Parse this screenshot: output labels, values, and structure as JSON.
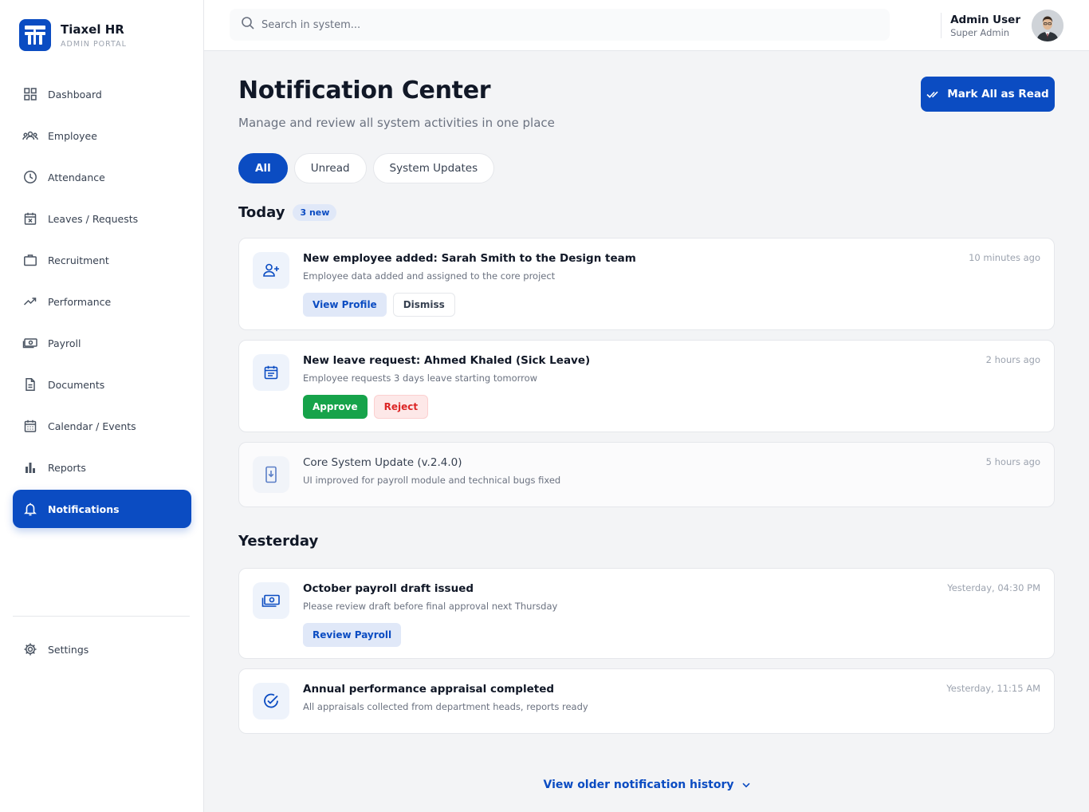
{
  "brand": {
    "name": "Tiaxel HR",
    "subtitle": "ADMIN PORTAL",
    "logo_icon": "tiaxel-logo"
  },
  "sidebar": {
    "items": [
      {
        "label": "Dashboard",
        "icon": "grid-icon"
      },
      {
        "label": "Employee",
        "icon": "users-icon"
      },
      {
        "label": "Attendance",
        "icon": "clock-icon"
      },
      {
        "label": "Leaves / Requests",
        "icon": "calendar-x-icon"
      },
      {
        "label": "Recruitment",
        "icon": "briefcase-icon"
      },
      {
        "label": "Performance",
        "icon": "trending-up-icon"
      },
      {
        "label": "Payroll",
        "icon": "banknote-icon"
      },
      {
        "label": "Documents",
        "icon": "file-icon"
      },
      {
        "label": "Calendar / Events",
        "icon": "calendar-icon"
      },
      {
        "label": "Reports",
        "icon": "bar-chart-icon"
      },
      {
        "label": "Notifications",
        "icon": "bell-icon",
        "active": true
      }
    ],
    "settings": {
      "label": "Settings",
      "icon": "gear-icon"
    }
  },
  "topbar": {
    "search_placeholder": "Search in system...",
    "user": {
      "name": "Admin User",
      "role": "Super Admin"
    }
  },
  "page": {
    "title": "Notification Center",
    "subtitle": "Manage and review all system activities in one place",
    "mark_all_label": "Mark All as Read"
  },
  "tabs": [
    {
      "label": "All",
      "active": true
    },
    {
      "label": "Unread"
    },
    {
      "label": "System Updates"
    }
  ],
  "today": {
    "heading": "Today",
    "badge": "3 new",
    "items": [
      {
        "title": "New employee added: Sarah Smith to the Design team",
        "description": "Employee data added and assigned to the core project",
        "time": "10 minutes ago",
        "icon": "user-plus-icon",
        "actions": [
          "View Profile",
          "Dismiss"
        ]
      },
      {
        "title": "New leave request: Ahmed Khaled (Sick Leave)",
        "description": "Employee requests 3 days leave starting tomorrow",
        "time": "2 hours ago",
        "icon": "calendar-list-icon",
        "actions": [
          "Approve",
          "Reject"
        ]
      },
      {
        "title": "Core System Update (v.2.4.0)",
        "description": "UI improved for payroll module and technical bugs fixed",
        "time": "5 hours ago",
        "icon": "device-download-icon",
        "actions": []
      }
    ]
  },
  "yesterday": {
    "heading": "Yesterday",
    "items": [
      {
        "title": "October payroll draft issued",
        "description": "Please review draft before final approval next Thursday",
        "time": "Yesterday, 04:30 PM",
        "icon": "banknote-icon",
        "actions": [
          "Review Payroll"
        ]
      },
      {
        "title": "Annual performance appraisal completed",
        "description": "All appraisals collected from department heads, reports ready",
        "time": "Yesterday, 11:15 AM",
        "icon": "check-circle-icon",
        "actions": []
      }
    ]
  },
  "footer": {
    "older_label": "View older notification history"
  },
  "colors": {
    "primary": "#0b4cc2",
    "success": "#16a34a",
    "danger": "#dc2626",
    "background": "#f3f4f6"
  }
}
